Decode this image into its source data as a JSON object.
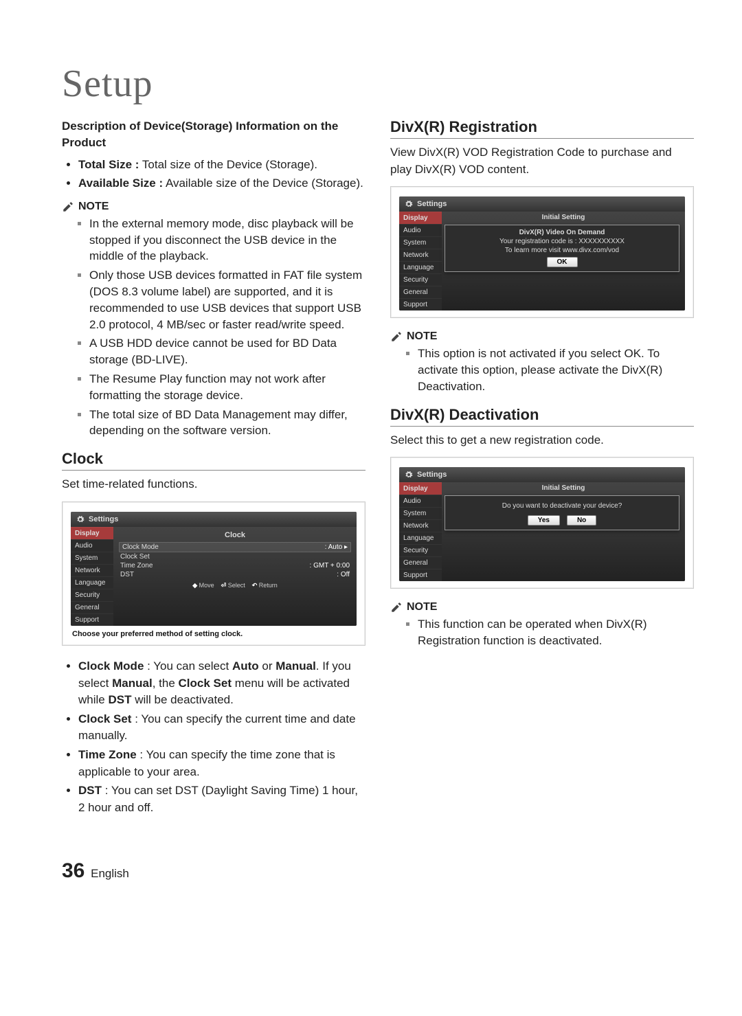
{
  "page": {
    "title": "Setup",
    "number": "36",
    "lang": "English"
  },
  "left": {
    "device_heading": "Description of Device(Storage) Information on the Product",
    "bullets": [
      {
        "b": "Total Size :",
        "rest": " Total size of the Device (Storage)."
      },
      {
        "b": "Available Size :",
        "rest": " Available size of the Device (Storage)."
      }
    ],
    "note_label": "NOTE",
    "notes": [
      "In the external memory mode, disc playback will be stopped if you disconnect the USB device in the middle of the playback.",
      "Only those USB devices formatted in FAT file system (DOS 8.3 volume label) are supported, and it is recommended to use USB devices that support USB 2.0 protocol, 4 MB/sec or faster read/write speed.",
      "A USB HDD device cannot be used for BD Data storage (BD-LIVE).",
      "The Resume Play function may not work after formatting the storage device.",
      "The total size of BD Data Management may differ, depending on the software version."
    ],
    "clock_heading": "Clock",
    "clock_intro": "Set time-related functions.",
    "clock_bullets": [
      {
        "pre": "Clock Mode",
        "mid": " : You can select ",
        "b1": "Auto",
        "mid2": " or ",
        "b2": "Manual",
        "tail": ". If you select ",
        "b3": "Manual",
        "tail2": ", the ",
        "b4": "Clock Set",
        "tail3": " menu will be activated while ",
        "b5": "DST",
        "tail4": " will be deactivated."
      },
      {
        "pre": "Clock Set",
        "mid": " : You can specify the current time and date manually."
      },
      {
        "pre": "Time Zone",
        "mid": " : You can specify the time zone that is applicable to your area."
      },
      {
        "pre": "DST",
        "mid": " : You can set DST (Daylight Saving Time) 1 hour, 2 hour and off."
      }
    ]
  },
  "right": {
    "reg_heading": "DivX(R) Registration",
    "reg_intro": "View DivX(R) VOD Registration Code to purchase and play DivX(R) VOD content.",
    "note_label": "NOTE",
    "reg_notes": [
      "This option is not activated if you select OK. To activate this option, please activate the DivX(R) Deactivation."
    ],
    "deact_heading": "DivX(R) Deactivation",
    "deact_intro": "Select this to get a new registration code.",
    "deact_notes": [
      "This function can be operated when DivX(R) Registration function is deactivated."
    ]
  },
  "ui": {
    "settings_label": "Settings",
    "nav": [
      "Display",
      "Audio",
      "System",
      "Network",
      "Language",
      "Security",
      "General",
      "Support"
    ],
    "clock": {
      "title": "Clock",
      "rows": [
        {
          "label": "Clock Mode",
          "value": ": Auto",
          "boxed": true,
          "caret": "▸"
        },
        {
          "label": "Clock Set",
          "value": ""
        },
        {
          "label": "Time Zone",
          "value": ": GMT + 0:00"
        },
        {
          "label": "DST",
          "value": ": Off"
        }
      ],
      "hints": {
        "move": "Move",
        "select": "Select",
        "return": "Return"
      },
      "caption": "Choose your preferred method of setting clock."
    },
    "reg_popup": {
      "header": "Initial Setting",
      "l1": "DivX(R) Video On Demand",
      "l2": "Your registration code is : XXXXXXXXXX",
      "l3": "To learn more visit www.divx.com/vod",
      "ok": "OK"
    },
    "deact_popup": {
      "header": "Initial Setting",
      "q": "Do you want to deactivate your device?",
      "yes": "Yes",
      "no": "No"
    }
  }
}
